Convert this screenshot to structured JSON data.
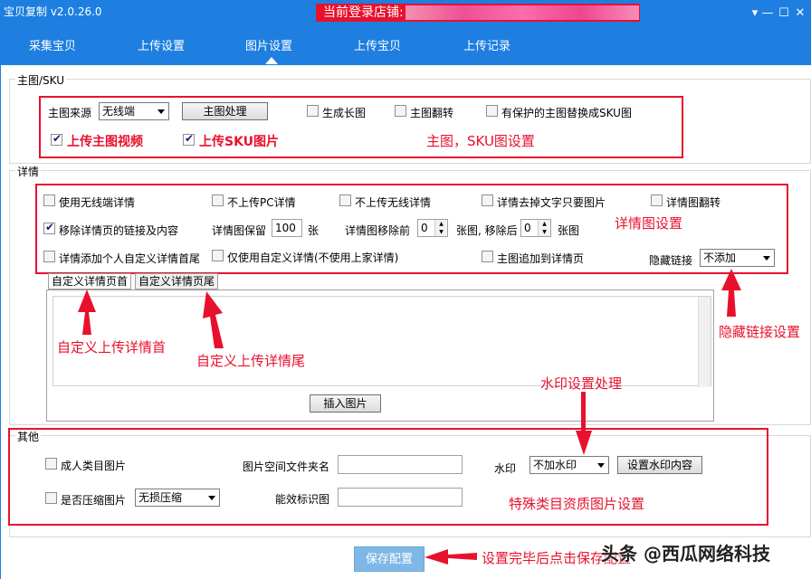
{
  "window": {
    "title": "宝贝复制 v2.0.26.0",
    "login_label": "当前登录店铺:",
    "controls": {
      "menu": "▾",
      "minimize": "—",
      "maximize": "☐",
      "close": "✕"
    }
  },
  "nav": {
    "tabs": [
      {
        "label": "采集宝贝"
      },
      {
        "label": "上传设置"
      },
      {
        "label": "图片设置",
        "active": true
      },
      {
        "label": "上传宝贝"
      },
      {
        "label": "上传记录"
      }
    ]
  },
  "main_sku": {
    "legend": "主图/SKU",
    "source_label": "主图来源",
    "source_value": "无线端",
    "process_button": "主图处理",
    "long_image": {
      "label": "生成长图",
      "checked": false
    },
    "flip": {
      "label": "主图翻转",
      "checked": false
    },
    "replace_protected": {
      "label": "有保护的主图替换成SKU图",
      "checked": false
    },
    "upload_video": {
      "label": "上传主图视频",
      "checked": true
    },
    "upload_sku": {
      "label": "上传SKU图片",
      "checked": true
    },
    "annotation": "主图，SKU图设置"
  },
  "detail": {
    "legend": "详情",
    "use_wireless": {
      "label": "使用无线端详情",
      "checked": false
    },
    "no_pc": {
      "label": "不上传PC详情",
      "checked": false
    },
    "no_wireless": {
      "label": "不上传无线详情",
      "checked": false
    },
    "remove_text": {
      "label": "详情去掉文字只要图片",
      "checked": false
    },
    "flip": {
      "label": "详情图翻转",
      "checked": false
    },
    "remove_links": {
      "label": "移除详情页的链接及内容",
      "checked": true
    },
    "keep_label": "详情图保留",
    "keep_value": "100",
    "keep_unit": "张",
    "move_before_label": "详情图移除前",
    "move_before_value": "0",
    "move_after_label": "张图, 移除后",
    "move_after_value": "0",
    "move_after_unit": "张图",
    "custom_head_tail": {
      "label": "详情添加个人自定义详情首尾",
      "checked": false
    },
    "only_custom": {
      "label": "仅使用自定义详情(不使用上家详情)",
      "checked": false
    },
    "append_main": {
      "label": "主图追加到详情页",
      "checked": false
    },
    "hide_link_label": "隐藏链接",
    "hide_link_value": "不添加",
    "annotation": "详情图设置",
    "tabs": [
      {
        "label": "自定义详情页首",
        "active": true
      },
      {
        "label": "自定义详情页尾"
      }
    ],
    "insert_button": "插入图片",
    "annot_head": "自定义上传详情首",
    "annot_tail": "自定义上传详情尾",
    "annot_hide": "隐藏链接设置"
  },
  "other": {
    "legend": "其他",
    "adult": {
      "label": "成人类目图片",
      "checked": false
    },
    "folder_label": "图片空间文件夹名",
    "folder_value": "",
    "watermark_label": "水印",
    "watermark_value": "不加水印",
    "watermark_button": "设置水印内容",
    "compress": {
      "label": "是否压缩图片",
      "checked": false
    },
    "compress_value": "无损压缩",
    "energy_label": "能效标识图",
    "energy_value": "",
    "annot_watermark": "水印设置处理",
    "annot_special": "特殊类目资质图片设置"
  },
  "footer": {
    "save_button": "保存配置",
    "annotation": "设置完毕后点击保存配置",
    "watermark": "头条 @西瓜网络科技"
  },
  "colors": {
    "titlebar": "#1e7fe0",
    "annotation": "#e8112d",
    "save_button": "#7fb8e6"
  }
}
